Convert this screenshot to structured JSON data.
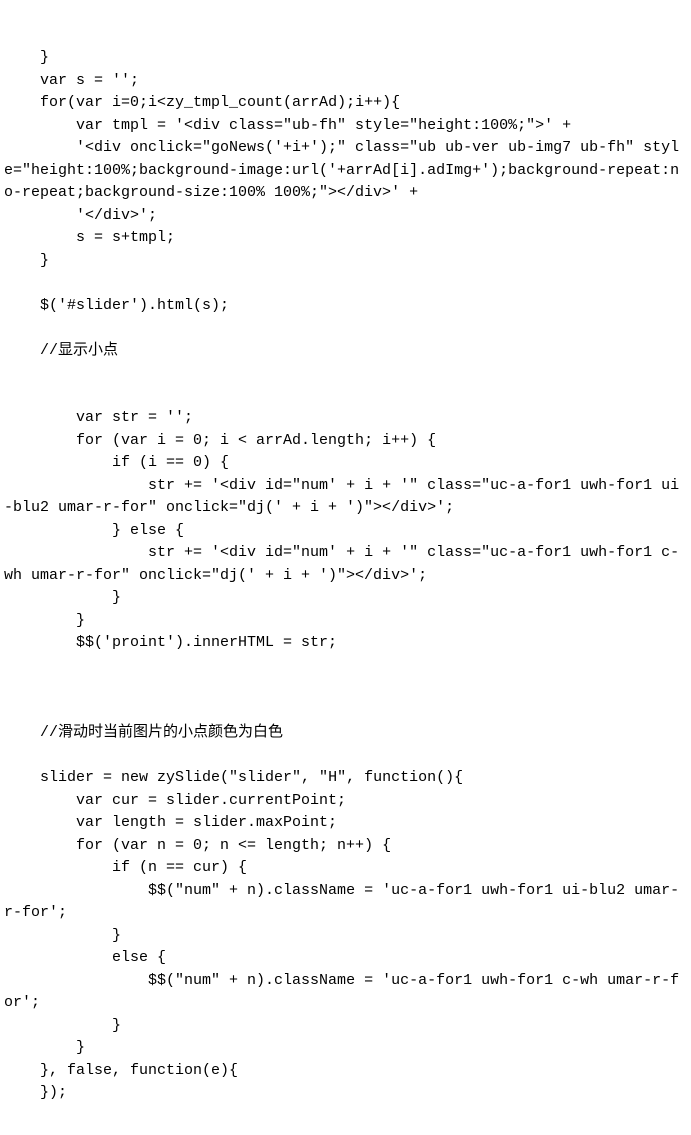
{
  "code_lines": [
    "    }",
    "    var s = '';",
    "    for(var i=0;i<zy_tmpl_count(arrAd);i++){",
    "        var tmpl = '<div class=\"ub-fh\" style=\"height:100%;\">' +",
    "        '<div onclick=\"goNews('+i+');\" class=\"ub ub-ver ub-img7 ub-fh\" style=\"height:100%;background-image:url('+arrAd[i].adImg+');background-repeat:no-repeat;background-size:100% 100%;\"></div>' +",
    "        '</div>';",
    "        s = s+tmpl;",
    "    }",
    "",
    "    $('#slider').html(s);",
    "",
    "    //显示小点",
    "",
    "",
    "        var str = '';",
    "        for (var i = 0; i < arrAd.length; i++) {",
    "            if (i == 0) {",
    "                str += '<div id=\"num' + i + '\" class=\"uc-a-for1 uwh-for1 ui-blu2 umar-r-for\" onclick=\"dj(' + i + ')\"></div>';",
    "            } else {",
    "                str += '<div id=\"num' + i + '\" class=\"uc-a-for1 uwh-for1 c-wh umar-r-for\" onclick=\"dj(' + i + ')\"></div>';",
    "            }",
    "        }",
    "        $$('proint').innerHTML = str;",
    "",
    "",
    "",
    "    //滑动时当前图片的小点颜色为白色",
    "",
    "    slider = new zySlide(\"slider\", \"H\", function(){",
    "        var cur = slider.currentPoint;",
    "        var length = slider.maxPoint;",
    "        for (var n = 0; n <= length; n++) {",
    "            if (n == cur) {",
    "                $$(\"num\" + n).className = 'uc-a-for1 uwh-for1 ui-blu2 umar-r-for';",
    "            }",
    "            else {",
    "                $$(\"num\" + n).className = 'uc-a-for1 uwh-for1 c-wh umar-r-for';",
    "            }",
    "        }",
    "    }, false, function(e){",
    "    });"
  ]
}
